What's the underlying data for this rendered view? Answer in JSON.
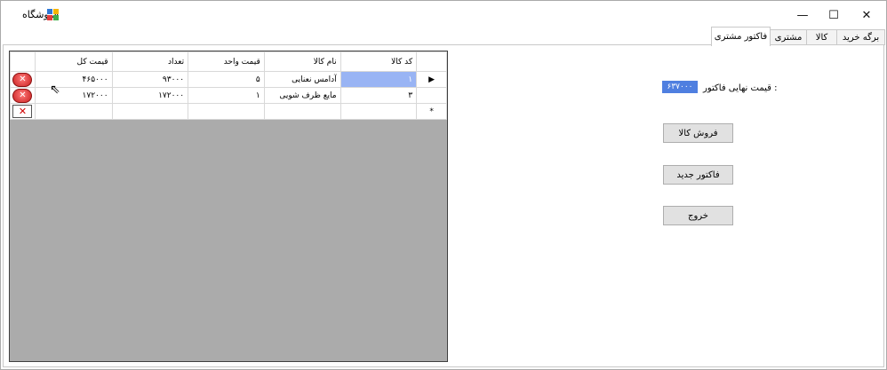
{
  "window": {
    "title": "فروشگاه",
    "icon": "app-grid-icon",
    "minimize": "—",
    "maximize": "☐",
    "close": "✕"
  },
  "tabs": [
    {
      "label": "برگه خرید",
      "active": false
    },
    {
      "label": "کالا",
      "active": false
    },
    {
      "label": "مشتری",
      "active": false
    },
    {
      "label": "فاکتور مشتری",
      "active": true
    }
  ],
  "grid": {
    "columns": [
      "قیمت کل",
      "تعداد",
      "قیمت واحد",
      "نام کالا",
      "کد کالا"
    ],
    "rows": [
      {
        "total": "۴۶۵۰۰۰",
        "qty": "۹۳۰۰۰",
        "unit_price": "۵",
        "name": "آدامس نعنایی",
        "code": "۱",
        "current": true
      },
      {
        "total": "۱۷۲۰۰۰",
        "qty": "۱۷۲۰۰۰",
        "unit_price": "۱",
        "name": "مایع ظرف شویی",
        "code": "۳",
        "current": false
      }
    ],
    "new_row_marker": "*",
    "current_row_marker": "▶"
  },
  "invoice": {
    "total_label": "قیمت نهایی فاکتور :",
    "total_value": "۶۳۷۰۰۰"
  },
  "buttons": {
    "sell": "فروش کالا",
    "new_invoice": "فاکتور جدید",
    "exit": "خروج"
  }
}
